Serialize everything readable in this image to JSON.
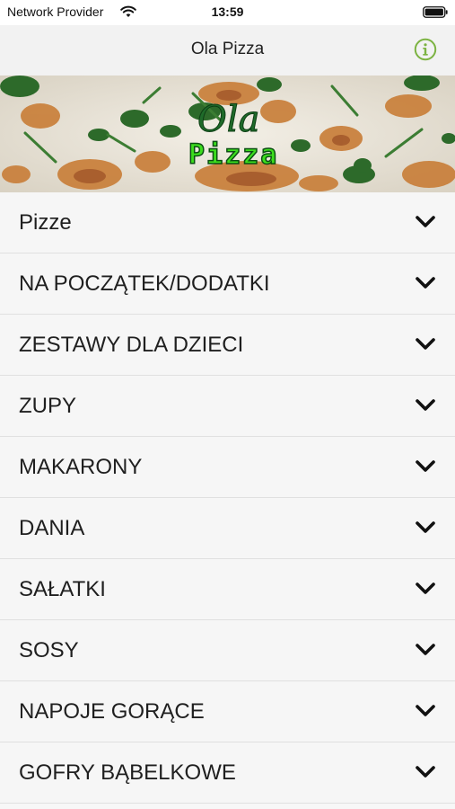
{
  "status_bar": {
    "carrier": "Network Provider",
    "time": "13:59",
    "wifi_icon": "wifi-icon",
    "battery_icon": "battery-icon"
  },
  "nav": {
    "title": "Ola Pizza",
    "info_icon": "info-icon",
    "accent_color": "#7cb342"
  },
  "banner": {
    "logo_line1": "Ola",
    "logo_line2": "Pizza"
  },
  "menu": {
    "items": [
      {
        "label": "Pizze"
      },
      {
        "label": "NA POCZĄTEK/DODATKI"
      },
      {
        "label": "ZESTAWY DLA DZIECI"
      },
      {
        "label": "ZUPY"
      },
      {
        "label": "MAKARONY"
      },
      {
        "label": "DANIA"
      },
      {
        "label": "SAŁATKI"
      },
      {
        "label": "SOSY"
      },
      {
        "label": "NAPOJE GORĄCE"
      },
      {
        "label": "GOFRY BĄBELKOWE"
      }
    ],
    "chevron_icon": "chevron-down-icon"
  }
}
